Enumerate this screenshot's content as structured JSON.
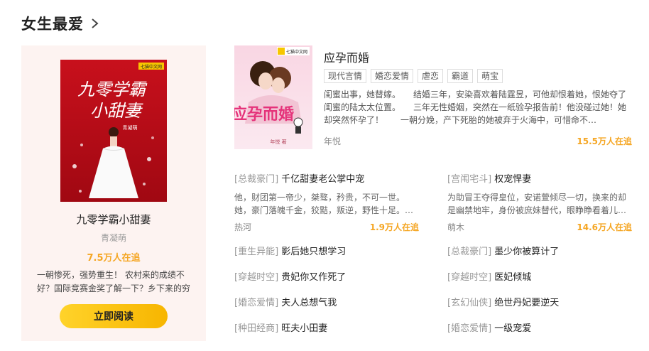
{
  "section": {
    "title": "女生最爱"
  },
  "featured": {
    "cover_title_line1": "九零学霸",
    "cover_title_line2": "小甜妻",
    "cover_author": "青凝萌",
    "cover_logo": "七猫中文网",
    "title": "九零学霸小甜妻",
    "author": "青凝萌",
    "readers": "7.5万人在追",
    "description": "一朝惨死，强势重生！ 农村来的成绩不好？国际竞赛金奖了解一下？乡下来的穷",
    "read_button": "立即阅读"
  },
  "top_book": {
    "cover_title": "应孕而婚",
    "cover_author": "年悦 著",
    "cover_logo": "七猫中文网",
    "title": "应孕而婚",
    "tags": [
      "现代言情",
      "婚恋爱情",
      "虐恋",
      "霸道",
      "萌宝"
    ],
    "description": "闺蜜出事，她替嫁。　　结婚三年，安染喜欢着陆霆昱，可他却恨着她，恨她夺了闺蜜的陆太太位置。　　三年无性婚姻，突然在一纸验孕报告前！他没碰过她！她却突然怀孕了！　　一朝分娩，产下死胎的她被弃于火海中，可惜命不…",
    "author": "年悦",
    "readers": "15.5万人在追"
  },
  "mid_books": [
    {
      "genre": "[总裁豪门]",
      "title": "千亿甜妻老公掌中宠",
      "description": "他，财团第一帝少，桀骜，矜贵，不可一世。她，豪门落魄千金，狡黠，叛逆，野性十足。…",
      "author": "热河",
      "readers": "1.9万人在追"
    },
    {
      "genre": "[宫闱宅斗]",
      "title": "权宠悍妻",
      "description": "为助冒王夺得皇位，安诺萱倾尽一切，换来的却是幽禁地牢，身份被庶妹替代，眼睁睁看着儿…",
      "author": "萌木",
      "readers": "14.6万人在追"
    }
  ],
  "list_books": [
    {
      "genre": "[重生异能]",
      "title": "影后她只想学习"
    },
    {
      "genre": "[总裁豪门]",
      "title": "墨少你被算计了"
    },
    {
      "genre": "[穿越时空]",
      "title": "贵妃你又作死了"
    },
    {
      "genre": "[穿越时空]",
      "title": "医妃倾城"
    },
    {
      "genre": "[婚恋爱情]",
      "title": "夫人总想气我"
    },
    {
      "genre": "[玄幻仙侠]",
      "title": "绝世丹妃要逆天"
    },
    {
      "genre": "[种田经商]",
      "title": "旺夫小田妻"
    },
    {
      "genre": "[婚恋爱情]",
      "title": "一级宠爱"
    }
  ]
}
